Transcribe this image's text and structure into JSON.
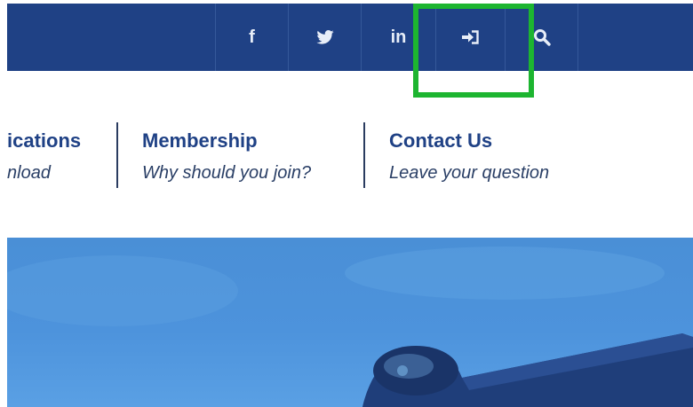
{
  "topbar": {
    "icons": [
      {
        "name": "facebook-icon",
        "glyph": "f"
      },
      {
        "name": "twitter-icon",
        "glyph": ""
      },
      {
        "name": "linkedin-icon",
        "glyph": "in"
      },
      {
        "name": "login-icon",
        "glyph": ""
      },
      {
        "name": "search-icon",
        "glyph": ""
      }
    ],
    "colors": {
      "bar": "#1f4185",
      "icon": "#e8eef8",
      "highlight": "#1db530"
    }
  },
  "nav": {
    "items": [
      {
        "title": "ications",
        "subtitle": "nload"
      },
      {
        "title": "Membership",
        "subtitle": "Why should you join?"
      },
      {
        "title": "Contact Us",
        "subtitle": "Leave your question"
      }
    ]
  }
}
